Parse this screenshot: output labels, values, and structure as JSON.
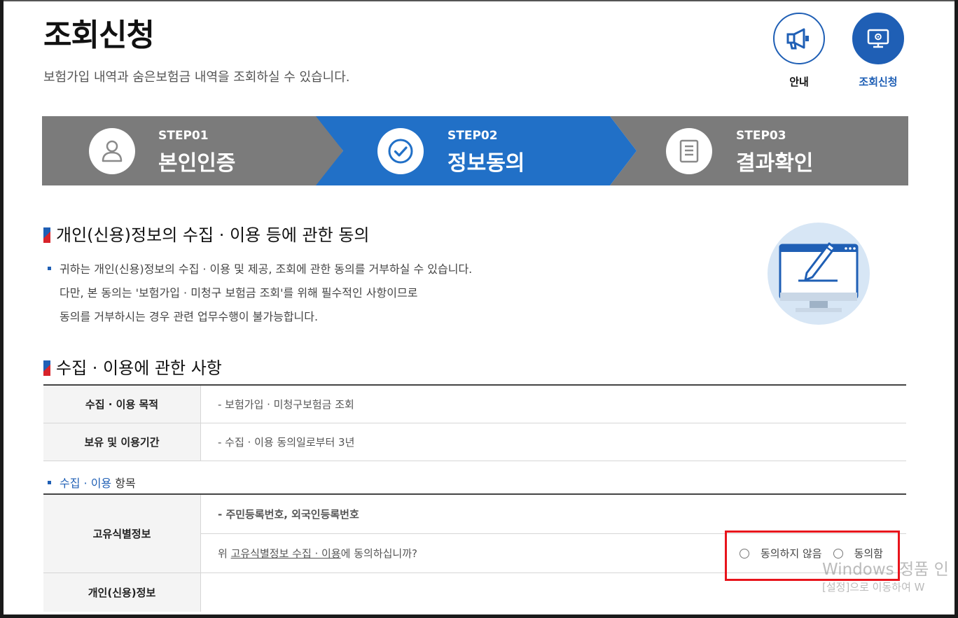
{
  "header": {
    "title": "조회신청",
    "subtitle": "보험가입 내역과 숨은보험금 내역을 조회하실 수 있습니다."
  },
  "top_buttons": [
    {
      "label": "안내",
      "icon": "megaphone-icon"
    },
    {
      "label": "조회신청",
      "icon": "monitor-gear-icon",
      "active": true
    }
  ],
  "steps": [
    {
      "num": "STEP01",
      "name": "본인인증",
      "icon": "person-icon",
      "active": false
    },
    {
      "num": "STEP02",
      "name": "정보동의",
      "icon": "check-circle-icon",
      "active": true
    },
    {
      "num": "STEP03",
      "name": "결과확인",
      "icon": "document-icon",
      "active": false
    }
  ],
  "colors": {
    "active": "#2170c7",
    "inactive": "#7b7b7b",
    "accent": "#1f5fb5",
    "highlight": "#e8141c"
  },
  "consent_section": {
    "title": "개인(신용)정보의 수집 · 이용 등에 관한 동의",
    "lines": [
      "귀하는 개인(신용)정보의 수집 · 이용 및 제공, 조회에 관한 동의를 거부하실 수 있습니다.",
      "다만, 본 동의는 '보험가입 · 미청구 보험금 조회'를 위해 필수적인 사항이므로",
      "동의를 거부하시는 경우 관련 업무수행이 불가능합니다."
    ]
  },
  "collection_section": {
    "title": "수집 · 이용에 관한 사항",
    "rows": [
      {
        "label": "수집 · 이용 목적",
        "value": "- 보험가입 · 미청구보험금 조회"
      },
      {
        "label": "보유 및 이용기간",
        "value": "- 수집 · 이용 동의일로부터 3년"
      }
    ],
    "items_heading_blue": "수집 · 이용",
    "items_heading_rest": " 항목",
    "unique_id": {
      "label": "고유식별정보",
      "value": "- 주민등록번호, 외국인등록번호",
      "question_pre": "위 ",
      "question_link": "고유식별정보 수집 · 이용",
      "question_post": "에 동의하십니까?",
      "options": [
        "동의하지 않음",
        "동의함"
      ]
    },
    "personal_credit": {
      "label": "개인(신용)정보"
    }
  },
  "watermark": {
    "line1": "Windows 정품 인",
    "line2": "[설정]으로 이동하여 W"
  }
}
